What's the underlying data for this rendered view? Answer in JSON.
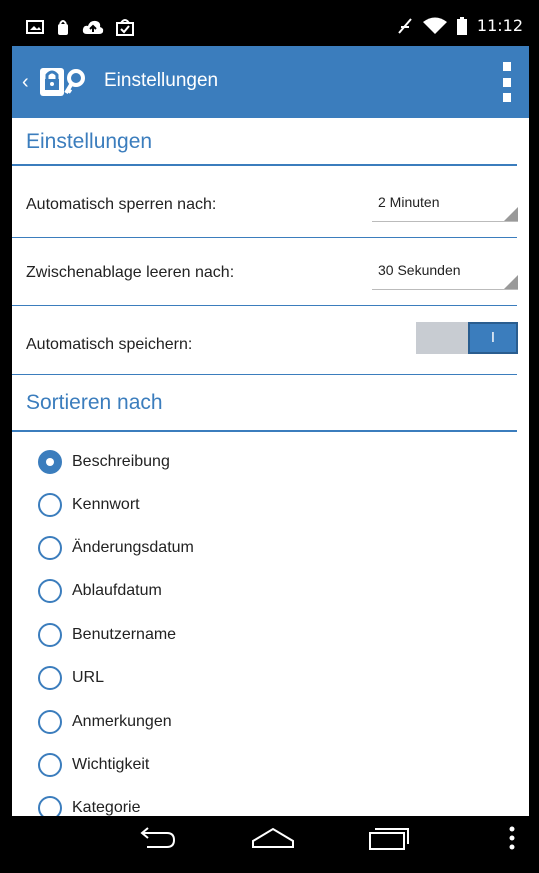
{
  "status_bar": {
    "time": "11:12",
    "icons": [
      "image-icon",
      "notification-icon",
      "cloud-upload-icon",
      "shopping-bag-icon",
      "signal-off-icon",
      "wifi-icon",
      "battery-icon"
    ]
  },
  "app_bar": {
    "title": "Einstellungen",
    "logo": "lock-key-logo-icon"
  },
  "settings_section": {
    "title": "Einstellungen",
    "auto_lock": {
      "label": "Automatisch sperren nach:",
      "value": "2 Minuten"
    },
    "clear_clipboard": {
      "label": "Zwischenablage leeren nach:",
      "value": "30 Sekunden"
    },
    "auto_save": {
      "label": "Automatisch speichern:",
      "toggle_text": "I",
      "checked": true
    }
  },
  "sort_section": {
    "title": "Sortieren nach",
    "options": [
      {
        "label": "Beschreibung",
        "checked": true
      },
      {
        "label": "Kennwort",
        "checked": false
      },
      {
        "label": "Änderungsdatum",
        "checked": false
      },
      {
        "label": "Ablaufdatum",
        "checked": false
      },
      {
        "label": "Benutzername",
        "checked": false
      },
      {
        "label": "URL",
        "checked": false
      },
      {
        "label": "Anmerkungen",
        "checked": false
      },
      {
        "label": "Wichtigkeit",
        "checked": false
      },
      {
        "label": "Kategorie",
        "checked": false
      }
    ]
  },
  "colors": {
    "accent": "#3b7dbd",
    "toggle_off": "#c8ccd2"
  }
}
